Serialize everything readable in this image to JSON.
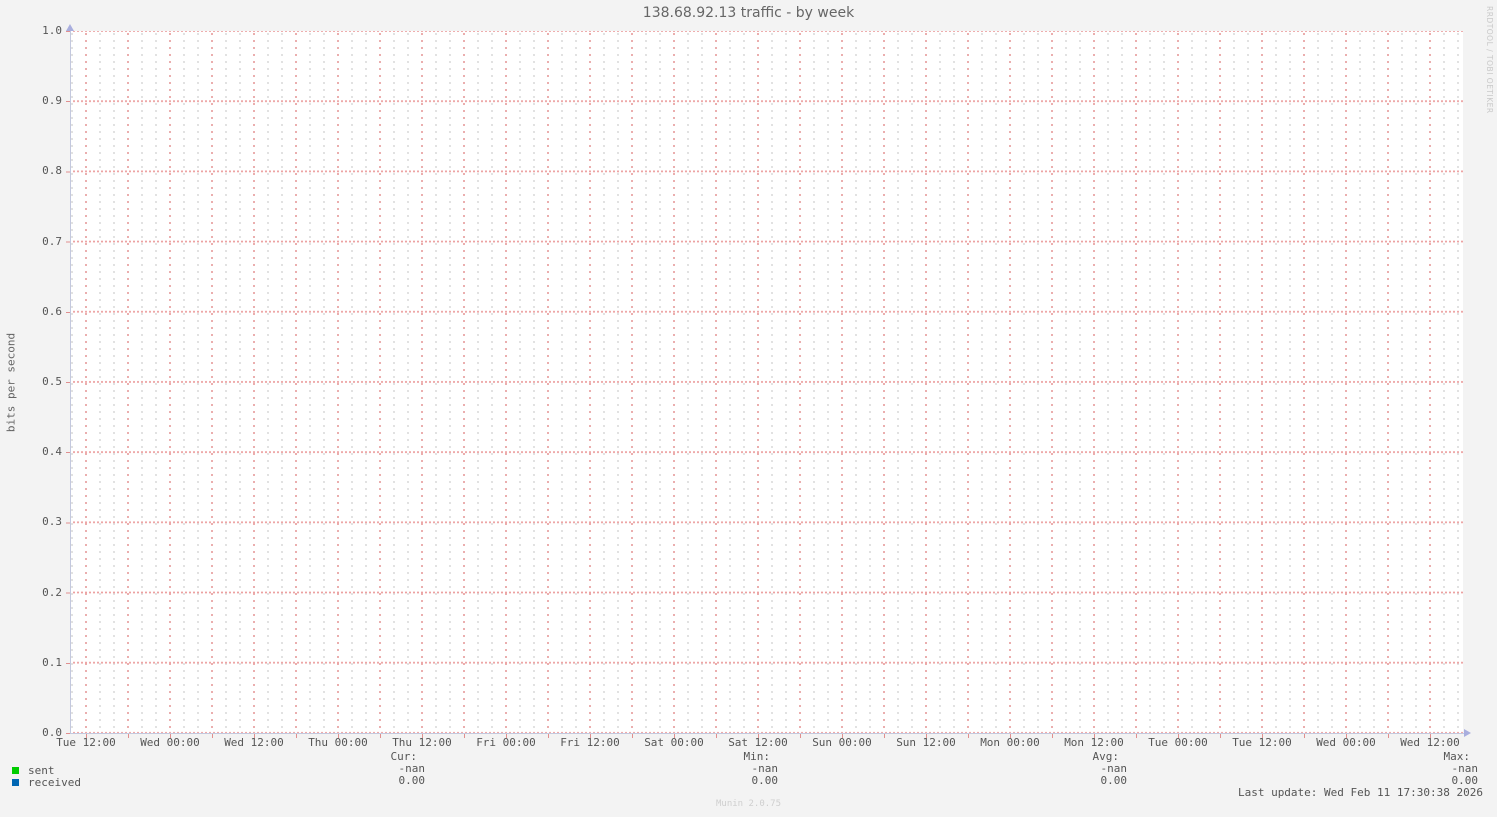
{
  "title": "138.68.92.13 traffic - by week",
  "y_axis": {
    "label": "bits per second",
    "ticks": [
      "1.0",
      "0.9",
      "0.8",
      "0.7",
      "0.6",
      "0.5",
      "0.4",
      "0.3",
      "0.2",
      "0.1",
      "0.0"
    ]
  },
  "x_axis": {
    "ticks": [
      "Tue 12:00",
      "Wed 00:00",
      "Wed 12:00",
      "Thu 00:00",
      "Thu 12:00",
      "Fri 00:00",
      "Fri 12:00",
      "Sat 00:00",
      "Sat 12:00",
      "Sun 00:00",
      "Sun 12:00",
      "Mon 00:00",
      "Mon 12:00",
      "Tue 00:00",
      "Tue 12:00",
      "Wed 00:00",
      "Wed 12:00"
    ]
  },
  "legend": {
    "items": [
      {
        "label": "sent",
        "color": "#00cc00",
        "swatch": "green-square-icon"
      },
      {
        "label": "received",
        "color": "#0066b3",
        "swatch": "blue-square-icon"
      }
    ]
  },
  "stats": {
    "columns": [
      {
        "header": "Cur:",
        "sent": "-nan",
        "received": "0.00"
      },
      {
        "header": "Min:",
        "sent": "-nan",
        "received": "0.00"
      },
      {
        "header": "Avg:",
        "sent": "-nan",
        "received": "0.00"
      },
      {
        "header": "Max:",
        "sent": "-nan",
        "received": "0.00"
      }
    ]
  },
  "footer": {
    "last_update": "Last update: Wed Feb 11 17:30:38 2026",
    "generator": "Munin 2.0.75"
  },
  "watermark": "RRDTOOL / TOBI OETIKER",
  "colors": {
    "background": "#f3f3f3",
    "plot_background": "#ffffff",
    "grid_major": "#eca1a1",
    "grid_minor": "#d9d9d9",
    "axis": "#c3c8de",
    "arrow": "#a9aede",
    "sent": "#00cc00",
    "received": "#0066b3",
    "text": "#555555"
  },
  "chart_data": {
    "type": "line",
    "title": "138.68.92.13 traffic - by week",
    "xlabel": "",
    "ylabel": "bits per second",
    "x_ticks": [
      "Tue 12:00",
      "Wed 00:00",
      "Wed 12:00",
      "Thu 00:00",
      "Thu 12:00",
      "Fri 00:00",
      "Fri 12:00",
      "Sat 00:00",
      "Sat 12:00",
      "Sun 00:00",
      "Sun 12:00",
      "Mon 00:00",
      "Mon 12:00",
      "Tue 00:00",
      "Tue 12:00",
      "Wed 00:00",
      "Wed 12:00"
    ],
    "ylim": [
      0.0,
      1.0
    ],
    "y_ticks": [
      0.0,
      0.1,
      0.2,
      0.3,
      0.4,
      0.5,
      0.6,
      0.7,
      0.8,
      0.9,
      1.0
    ],
    "grid": true,
    "legend_position": "bottom-left",
    "series": [
      {
        "name": "sent",
        "color": "#00cc00",
        "values": [],
        "cur": "-nan",
        "min": "-nan",
        "avg": "-nan",
        "max": "-nan"
      },
      {
        "name": "received",
        "color": "#0066b3",
        "values": [],
        "cur": "0.00",
        "min": "0.00",
        "avg": "0.00",
        "max": "0.00"
      }
    ]
  }
}
